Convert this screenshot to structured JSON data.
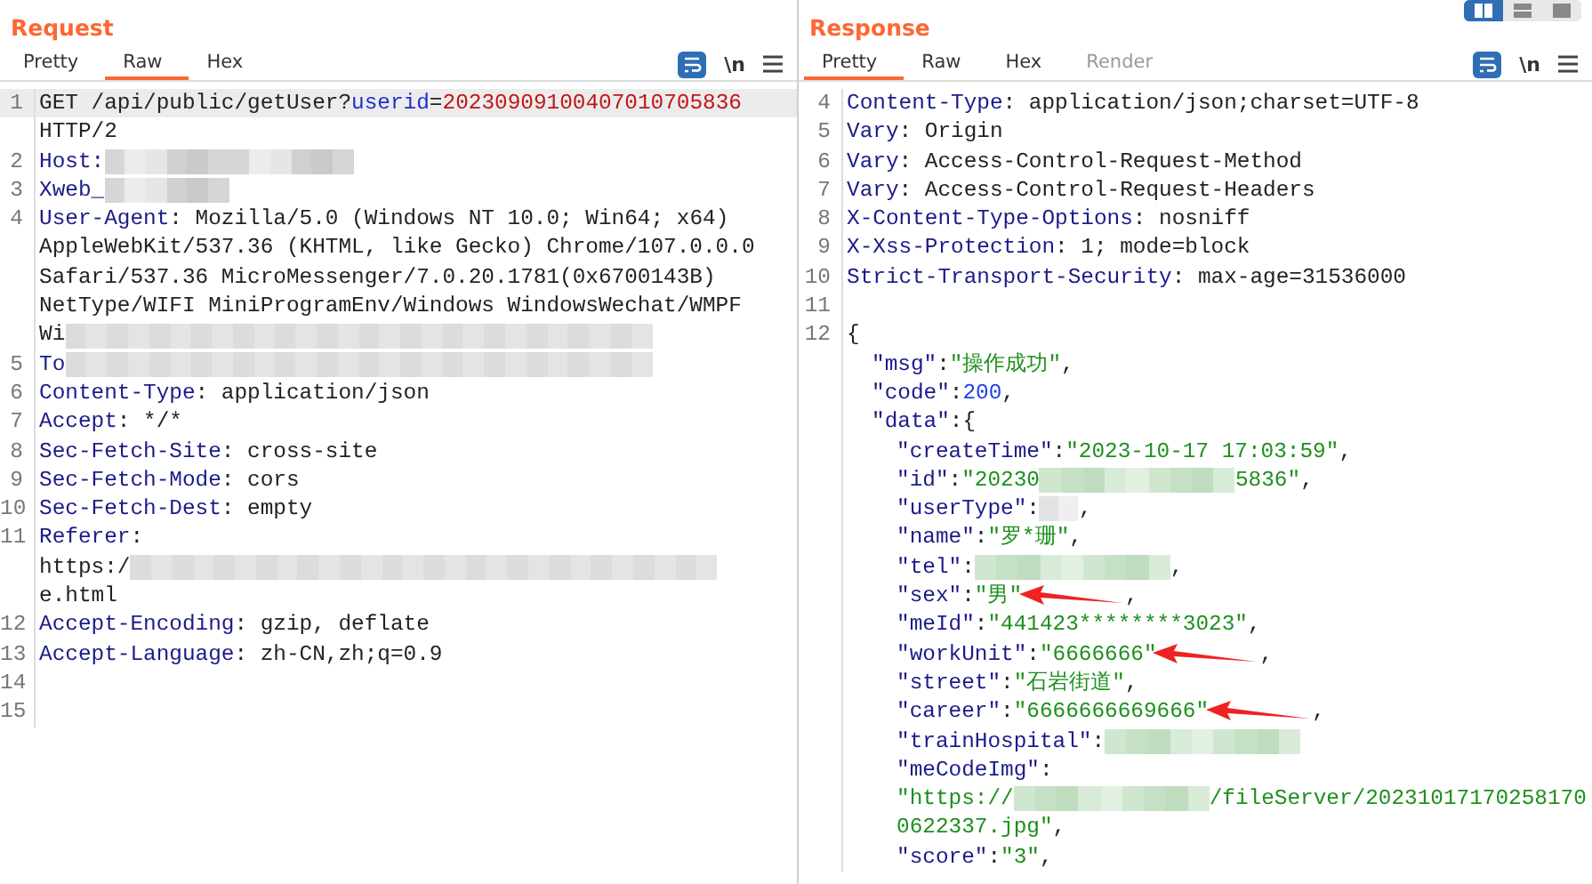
{
  "request": {
    "title": "Request",
    "tabs": [
      {
        "label": "Pretty",
        "selected": false,
        "disabled": false
      },
      {
        "label": "Raw",
        "selected": true,
        "disabled": false
      },
      {
        "label": "Hex",
        "selected": false,
        "disabled": false
      }
    ],
    "wrap_on": true,
    "newline_toggle": "\\n",
    "lines": [
      {
        "num": "1",
        "highlighted": true,
        "parts": [
          {
            "kind": "text",
            "text": "GET /api/public/getUser?"
          },
          {
            "kind": "param",
            "text": "userid"
          },
          {
            "kind": "text",
            "text": "="
          },
          {
            "kind": "value",
            "text": "20230909100407010705836"
          }
        ]
      },
      {
        "highlighted": false,
        "parts": [
          {
            "kind": "text",
            "text": "HTTP/2"
          }
        ]
      },
      {
        "num": "2",
        "highlighted": false,
        "parts": [
          {
            "kind": "key",
            "text": "Host:"
          },
          {
            "kind": "mask"
          },
          {
            "kind": "mask"
          }
        ]
      },
      {
        "num": "3",
        "highlighted": false,
        "parts": [
          {
            "kind": "key",
            "text": "Xweb_"
          },
          {
            "kind": "mask"
          }
        ]
      },
      {
        "num": "4",
        "highlighted": false,
        "parts": [
          {
            "kind": "key",
            "text": "User-Agent"
          },
          {
            "kind": "text",
            "text": ": Mozilla/5.0 (Windows NT 10.0; Win64; x64)"
          }
        ]
      },
      {
        "highlighted": false,
        "parts": [
          {
            "kind": "text",
            "text": "AppleWebKit/537.36 (KHTML, like Gecko) Chrome/107.0.0.0"
          }
        ]
      },
      {
        "highlighted": false,
        "parts": [
          {
            "kind": "text",
            "text": "Safari/537.36 MicroMessenger/7.0.20.1781(0x6700143B)"
          }
        ]
      },
      {
        "highlighted": false,
        "parts": [
          {
            "kind": "text",
            "text": "NetType/WIFI MiniProgramEnv/Windows WindowsWechat/WMPF"
          }
        ]
      },
      {
        "highlighted": false,
        "parts": [
          {
            "kind": "text",
            "text": "Wi"
          },
          {
            "kind": "longmask"
          }
        ]
      },
      {
        "num": "5",
        "highlighted": false,
        "parts": [
          {
            "kind": "key",
            "text": "To"
          },
          {
            "kind": "longmask"
          }
        ]
      },
      {
        "num": "6",
        "highlighted": false,
        "parts": [
          {
            "kind": "key",
            "text": "Content-Type"
          },
          {
            "kind": "text",
            "text": ": application/json"
          }
        ]
      },
      {
        "num": "7",
        "highlighted": false,
        "parts": [
          {
            "kind": "key",
            "text": "Accept"
          },
          {
            "kind": "text",
            "text": ": */*"
          }
        ]
      },
      {
        "num": "8",
        "highlighted": false,
        "parts": [
          {
            "kind": "key",
            "text": "Sec-Fetch-Site"
          },
          {
            "kind": "text",
            "text": ": cross-site"
          }
        ]
      },
      {
        "num": "9",
        "highlighted": false,
        "parts": [
          {
            "kind": "key",
            "text": "Sec-Fetch-Mode"
          },
          {
            "kind": "text",
            "text": ": cors"
          }
        ]
      },
      {
        "num": "10",
        "highlighted": false,
        "parts": [
          {
            "kind": "key",
            "text": "Sec-Fetch-Dest"
          },
          {
            "kind": "text",
            "text": ": empty"
          }
        ]
      },
      {
        "num": "11",
        "highlighted": false,
        "parts": [
          {
            "kind": "key",
            "text": "Referer"
          },
          {
            "kind": "text",
            "text": ":"
          }
        ]
      },
      {
        "highlighted": false,
        "parts": [
          {
            "kind": "text",
            "text": "https:/"
          },
          {
            "kind": "longmask"
          }
        ]
      },
      {
        "highlighted": false,
        "parts": [
          {
            "kind": "text",
            "text": "e.html"
          }
        ]
      },
      {
        "num": "12",
        "highlighted": false,
        "parts": [
          {
            "kind": "key",
            "text": "Accept-Encoding"
          },
          {
            "kind": "text",
            "text": ": gzip, deflate"
          }
        ]
      },
      {
        "num": "13",
        "highlighted": false,
        "parts": [
          {
            "kind": "key",
            "text": "Accept-Language"
          },
          {
            "kind": "text",
            "text": ": zh-CN,zh;q=0.9"
          }
        ]
      },
      {
        "num": "14",
        "highlighted": false
      },
      {
        "num": "15",
        "highlighted": false
      }
    ]
  },
  "response": {
    "title": "Response",
    "tabs": [
      {
        "label": "Pretty",
        "selected": true,
        "disabled": false
      },
      {
        "label": "Raw",
        "selected": false,
        "disabled": false
      },
      {
        "label": "Hex",
        "selected": false,
        "disabled": false
      },
      {
        "label": "Render",
        "selected": false,
        "disabled": true
      }
    ],
    "wrap_on": true,
    "newline_toggle": "\\n",
    "layouts": [
      {
        "selected": true
      },
      {
        "selected": false
      },
      {
        "selected": false
      }
    ],
    "lines": [
      {
        "num": "4",
        "parts": [
          {
            "kind": "key",
            "text": "Content-Type"
          },
          {
            "kind": "text",
            "text": ": application/json;charset=UTF-8"
          }
        ]
      },
      {
        "num": "5",
        "parts": [
          {
            "kind": "key",
            "text": "Vary"
          },
          {
            "kind": "text",
            "text": ": Origin"
          }
        ]
      },
      {
        "num": "6",
        "parts": [
          {
            "kind": "key",
            "text": "Vary"
          },
          {
            "kind": "text",
            "text": ": Access-Control-Request-Method"
          }
        ]
      },
      {
        "num": "7",
        "parts": [
          {
            "kind": "key",
            "text": "Vary"
          },
          {
            "kind": "text",
            "text": ": Access-Control-Request-Headers"
          }
        ]
      },
      {
        "num": "8",
        "parts": [
          {
            "kind": "key",
            "text": "X-Content-Type-Options"
          },
          {
            "kind": "text",
            "text": ": nosniff"
          }
        ]
      },
      {
        "num": "9",
        "parts": [
          {
            "kind": "key",
            "text": "X-Xss-Protection"
          },
          {
            "kind": "text",
            "text": ": 1; mode=block"
          }
        ]
      },
      {
        "num": "10",
        "parts": [
          {
            "kind": "key",
            "text": "Strict-Transport-Security"
          },
          {
            "kind": "text",
            "text": ": max-age=31536000"
          }
        ]
      },
      {
        "num": "11"
      },
      {
        "num": "12",
        "parts": [
          {
            "kind": "text",
            "text": "{"
          }
        ]
      },
      {
        "parts": [
          {
            "kind": "indent1"
          },
          {
            "kind": "key",
            "text": "\"msg\""
          },
          {
            "kind": "text",
            "text": ":"
          },
          {
            "kind": "string",
            "text": "\"操作成功\""
          },
          {
            "kind": "text",
            "text": ","
          }
        ]
      },
      {
        "parts": [
          {
            "kind": "indent1"
          },
          {
            "kind": "key",
            "text": "\"code\""
          },
          {
            "kind": "text",
            "text": ":"
          },
          {
            "kind": "number",
            "text": "200"
          },
          {
            "kind": "text",
            "text": ","
          }
        ]
      },
      {
        "parts": [
          {
            "kind": "indent1"
          },
          {
            "kind": "key",
            "text": "\"data\""
          },
          {
            "kind": "text",
            "text": ":{"
          }
        ]
      },
      {
        "parts": [
          {
            "kind": "indent2"
          },
          {
            "kind": "key",
            "text": "\"createTime\""
          },
          {
            "kind": "text",
            "text": ":"
          },
          {
            "kind": "string",
            "text": "\"2023-10-17 17:03:59\""
          },
          {
            "kind": "text",
            "text": ","
          }
        ]
      },
      {
        "parts": [
          {
            "kind": "indent2"
          },
          {
            "kind": "key",
            "text": "\"id\""
          },
          {
            "kind": "text",
            "text": ":"
          },
          {
            "kind": "string",
            "text": "\"20230"
          },
          {
            "kind": "greenmask"
          },
          {
            "kind": "string",
            "text": "5836\""
          },
          {
            "kind": "text",
            "text": ","
          }
        ]
      },
      {
        "parts": [
          {
            "kind": "indent2"
          },
          {
            "kind": "key",
            "text": "\"userType\""
          },
          {
            "kind": "text",
            "text": ":"
          },
          {
            "kind": "shortmask"
          },
          {
            "kind": "text",
            "text": ","
          }
        ]
      },
      {
        "parts": [
          {
            "kind": "indent2"
          },
          {
            "kind": "key",
            "text": "\"name\""
          },
          {
            "kind": "text",
            "text": ":"
          },
          {
            "kind": "string",
            "text": "\"罗*珊\""
          },
          {
            "kind": "text",
            "text": ","
          }
        ]
      },
      {
        "parts": [
          {
            "kind": "indent2"
          },
          {
            "kind": "key",
            "text": "\"tel\""
          },
          {
            "kind": "text",
            "text": ":"
          },
          {
            "kind": "greenmask"
          },
          {
            "kind": "text",
            "text": ","
          }
        ]
      },
      {
        "parts": [
          {
            "kind": "indent2"
          },
          {
            "kind": "key",
            "text": "\"sex\""
          },
          {
            "kind": "text",
            "text": ":"
          },
          {
            "kind": "string",
            "text": "\"男\""
          },
          {
            "kind": "arrow"
          },
          {
            "kind": "text",
            "text": ","
          }
        ]
      },
      {
        "parts": [
          {
            "kind": "indent2"
          },
          {
            "kind": "key",
            "text": "\"meId\""
          },
          {
            "kind": "text",
            "text": ":"
          },
          {
            "kind": "string",
            "text": "\"441423********3023\""
          },
          {
            "kind": "text",
            "text": ","
          }
        ]
      },
      {
        "parts": [
          {
            "kind": "indent2"
          },
          {
            "kind": "key",
            "text": "\"workUnit\""
          },
          {
            "kind": "text",
            "text": ":"
          },
          {
            "kind": "string",
            "text": "\"6666666\""
          },
          {
            "kind": "arrow"
          },
          {
            "kind": "text",
            "text": ","
          }
        ]
      },
      {
        "parts": [
          {
            "kind": "indent2"
          },
          {
            "kind": "key",
            "text": "\"street\""
          },
          {
            "kind": "text",
            "text": ":"
          },
          {
            "kind": "string",
            "text": "\"石岩街道\""
          },
          {
            "kind": "text",
            "text": ","
          }
        ]
      },
      {
        "parts": [
          {
            "kind": "indent2"
          },
          {
            "kind": "key",
            "text": "\"career\""
          },
          {
            "kind": "text",
            "text": ":"
          },
          {
            "kind": "string",
            "text": "\"6666666669666\""
          },
          {
            "kind": "arrow"
          },
          {
            "kind": "text",
            "text": ","
          }
        ]
      },
      {
        "parts": [
          {
            "kind": "indent2"
          },
          {
            "kind": "key",
            "text": "\"trainHospital\""
          },
          {
            "kind": "text",
            "text": ":"
          },
          {
            "kind": "greenmask"
          }
        ]
      },
      {
        "parts": [
          {
            "kind": "indent2"
          },
          {
            "kind": "key",
            "text": "\"meCodeImg\""
          },
          {
            "kind": "text",
            "text": ":"
          }
        ]
      },
      {
        "parts": [
          {
            "kind": "indent2"
          },
          {
            "kind": "string",
            "text": "\"https://"
          },
          {
            "kind": "greenmask"
          },
          {
            "kind": "string",
            "text": "/fileServer/20231017170258170"
          }
        ]
      },
      {
        "parts": [
          {
            "kind": "indent2"
          },
          {
            "kind": "string",
            "text": "0622337.jpg\""
          },
          {
            "kind": "text",
            "text": ","
          }
        ]
      },
      {
        "parts": [
          {
            "kind": "indent2"
          },
          {
            "kind": "key",
            "text": "\"score\""
          },
          {
            "kind": "text",
            "text": ":"
          },
          {
            "kind": "string",
            "text": "\"3\""
          },
          {
            "kind": "text",
            "text": ","
          }
        ]
      }
    ]
  }
}
